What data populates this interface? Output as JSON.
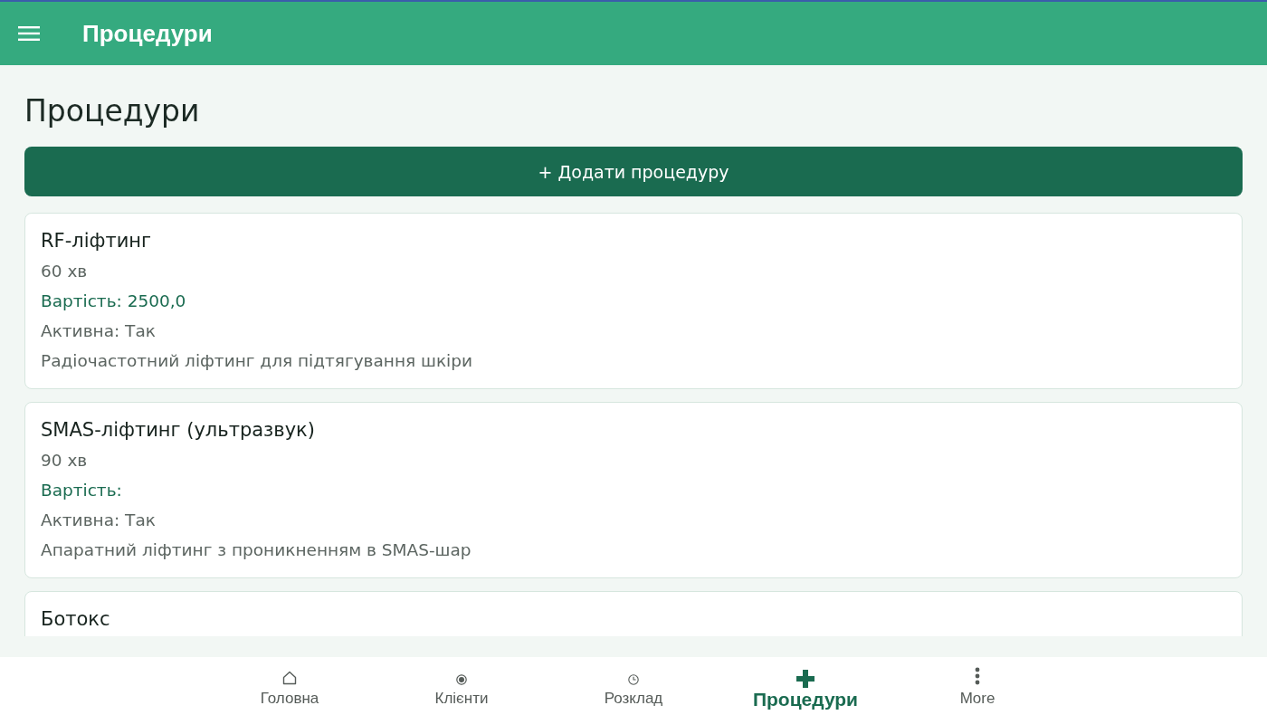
{
  "app_bar": {
    "title": "Процедури"
  },
  "page": {
    "heading": "Процедури",
    "add_button": "+ Додати процедуру"
  },
  "procedures": [
    {
      "name": "RF-ліфтинг",
      "duration": "60 хв",
      "price": "Вартість: 2500,0",
      "active": "Активна: Так",
      "description": "Радіочастотний ліфтинг для підтягування шкіри"
    },
    {
      "name": "SMAS-ліфтинг (ультразвук)",
      "duration": "90 хв",
      "price": "Вартість:",
      "active": "Активна: Так",
      "description": "Апаратний ліфтинг з проникненням в SMAS-шар"
    },
    {
      "name": "Ботокс"
    }
  ],
  "bottom_nav": [
    {
      "label": "Головна",
      "selected": false
    },
    {
      "label": "Клієнти",
      "selected": false
    },
    {
      "label": "Розклад",
      "selected": false
    },
    {
      "label": "Процедури",
      "selected": true
    },
    {
      "label": "More",
      "selected": false
    }
  ]
}
